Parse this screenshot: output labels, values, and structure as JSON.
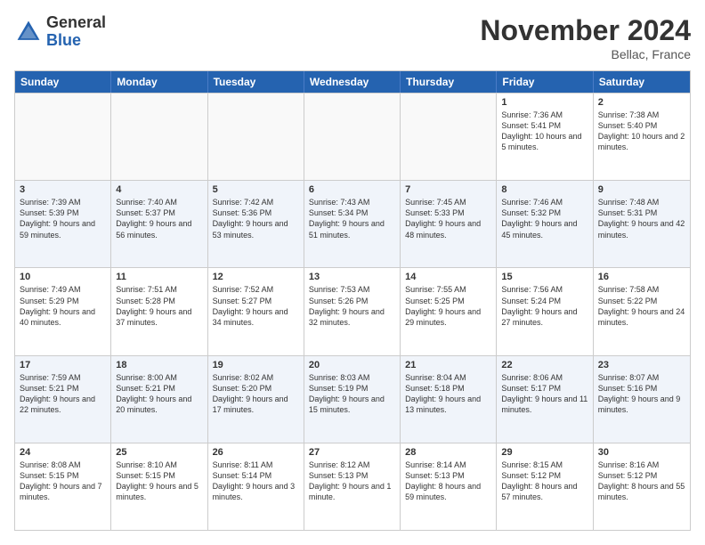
{
  "header": {
    "logo_general": "General",
    "logo_blue": "Blue",
    "month_title": "November 2024",
    "location": "Bellac, France"
  },
  "calendar": {
    "days": [
      "Sunday",
      "Monday",
      "Tuesday",
      "Wednesday",
      "Thursday",
      "Friday",
      "Saturday"
    ],
    "rows": [
      [
        {
          "day": "",
          "text": ""
        },
        {
          "day": "",
          "text": ""
        },
        {
          "day": "",
          "text": ""
        },
        {
          "day": "",
          "text": ""
        },
        {
          "day": "",
          "text": ""
        },
        {
          "day": "1",
          "text": "Sunrise: 7:36 AM\nSunset: 5:41 PM\nDaylight: 10 hours and 5 minutes."
        },
        {
          "day": "2",
          "text": "Sunrise: 7:38 AM\nSunset: 5:40 PM\nDaylight: 10 hours and 2 minutes."
        }
      ],
      [
        {
          "day": "3",
          "text": "Sunrise: 7:39 AM\nSunset: 5:39 PM\nDaylight: 9 hours and 59 minutes."
        },
        {
          "day": "4",
          "text": "Sunrise: 7:40 AM\nSunset: 5:37 PM\nDaylight: 9 hours and 56 minutes."
        },
        {
          "day": "5",
          "text": "Sunrise: 7:42 AM\nSunset: 5:36 PM\nDaylight: 9 hours and 53 minutes."
        },
        {
          "day": "6",
          "text": "Sunrise: 7:43 AM\nSunset: 5:34 PM\nDaylight: 9 hours and 51 minutes."
        },
        {
          "day": "7",
          "text": "Sunrise: 7:45 AM\nSunset: 5:33 PM\nDaylight: 9 hours and 48 minutes."
        },
        {
          "day": "8",
          "text": "Sunrise: 7:46 AM\nSunset: 5:32 PM\nDaylight: 9 hours and 45 minutes."
        },
        {
          "day": "9",
          "text": "Sunrise: 7:48 AM\nSunset: 5:31 PM\nDaylight: 9 hours and 42 minutes."
        }
      ],
      [
        {
          "day": "10",
          "text": "Sunrise: 7:49 AM\nSunset: 5:29 PM\nDaylight: 9 hours and 40 minutes."
        },
        {
          "day": "11",
          "text": "Sunrise: 7:51 AM\nSunset: 5:28 PM\nDaylight: 9 hours and 37 minutes."
        },
        {
          "day": "12",
          "text": "Sunrise: 7:52 AM\nSunset: 5:27 PM\nDaylight: 9 hours and 34 minutes."
        },
        {
          "day": "13",
          "text": "Sunrise: 7:53 AM\nSunset: 5:26 PM\nDaylight: 9 hours and 32 minutes."
        },
        {
          "day": "14",
          "text": "Sunrise: 7:55 AM\nSunset: 5:25 PM\nDaylight: 9 hours and 29 minutes."
        },
        {
          "day": "15",
          "text": "Sunrise: 7:56 AM\nSunset: 5:24 PM\nDaylight: 9 hours and 27 minutes."
        },
        {
          "day": "16",
          "text": "Sunrise: 7:58 AM\nSunset: 5:22 PM\nDaylight: 9 hours and 24 minutes."
        }
      ],
      [
        {
          "day": "17",
          "text": "Sunrise: 7:59 AM\nSunset: 5:21 PM\nDaylight: 9 hours and 22 minutes."
        },
        {
          "day": "18",
          "text": "Sunrise: 8:00 AM\nSunset: 5:21 PM\nDaylight: 9 hours and 20 minutes."
        },
        {
          "day": "19",
          "text": "Sunrise: 8:02 AM\nSunset: 5:20 PM\nDaylight: 9 hours and 17 minutes."
        },
        {
          "day": "20",
          "text": "Sunrise: 8:03 AM\nSunset: 5:19 PM\nDaylight: 9 hours and 15 minutes."
        },
        {
          "day": "21",
          "text": "Sunrise: 8:04 AM\nSunset: 5:18 PM\nDaylight: 9 hours and 13 minutes."
        },
        {
          "day": "22",
          "text": "Sunrise: 8:06 AM\nSunset: 5:17 PM\nDaylight: 9 hours and 11 minutes."
        },
        {
          "day": "23",
          "text": "Sunrise: 8:07 AM\nSunset: 5:16 PM\nDaylight: 9 hours and 9 minutes."
        }
      ],
      [
        {
          "day": "24",
          "text": "Sunrise: 8:08 AM\nSunset: 5:15 PM\nDaylight: 9 hours and 7 minutes."
        },
        {
          "day": "25",
          "text": "Sunrise: 8:10 AM\nSunset: 5:15 PM\nDaylight: 9 hours and 5 minutes."
        },
        {
          "day": "26",
          "text": "Sunrise: 8:11 AM\nSunset: 5:14 PM\nDaylight: 9 hours and 3 minutes."
        },
        {
          "day": "27",
          "text": "Sunrise: 8:12 AM\nSunset: 5:13 PM\nDaylight: 9 hours and 1 minute."
        },
        {
          "day": "28",
          "text": "Sunrise: 8:14 AM\nSunset: 5:13 PM\nDaylight: 8 hours and 59 minutes."
        },
        {
          "day": "29",
          "text": "Sunrise: 8:15 AM\nSunset: 5:12 PM\nDaylight: 8 hours and 57 minutes."
        },
        {
          "day": "30",
          "text": "Sunrise: 8:16 AM\nSunset: 5:12 PM\nDaylight: 8 hours and 55 minutes."
        }
      ]
    ]
  }
}
